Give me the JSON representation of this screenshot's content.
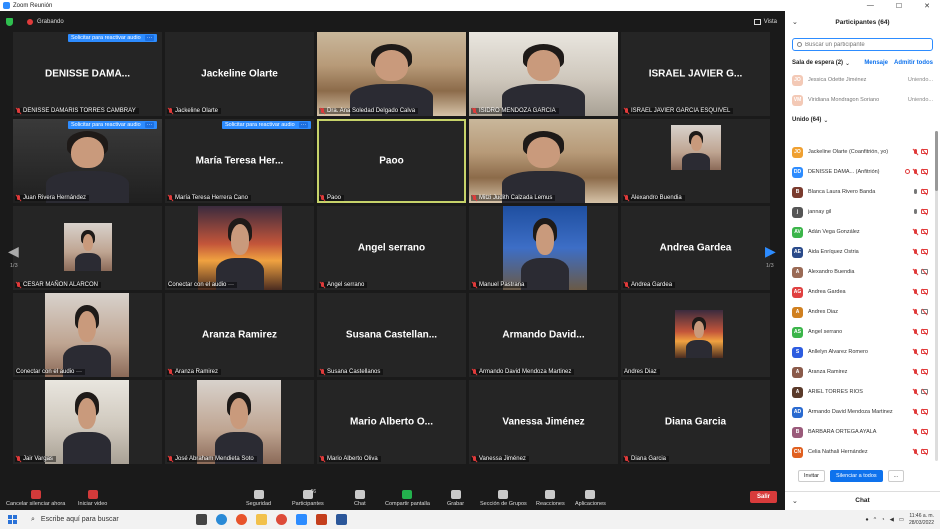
{
  "window": {
    "title": "Zoom Reunión"
  },
  "topbar": {
    "recording_label": "Grabando",
    "view_label": "Vista"
  },
  "unmute_request": {
    "label": "Solicitar para reactivar audio",
    "more": "···"
  },
  "tiles": [
    {
      "display": "DENISSE  DAMA...",
      "label": "DENISSE DAMARIS TORRES CAMBRAY",
      "video": false,
      "request": true
    },
    {
      "display": "Jackeline Olarte",
      "label": "Jackeline Olarte",
      "video": false,
      "request": false
    },
    {
      "display": "",
      "label": "Dra. Ana Soledad Delgado Calva",
      "video": true,
      "request": false
    },
    {
      "display": "",
      "label": "ISIDRO MENDOZA GARCIA",
      "video": true,
      "request": false
    },
    {
      "display": "ISRAEL JAVIER G...",
      "label": "ISRAEL JAVIER GARCIA ESQUIVEL",
      "video": false,
      "request": false
    },
    {
      "display": "",
      "label": "Juan Rivera Hernández",
      "video": true,
      "request": true
    },
    {
      "display": "María Teresa Her...",
      "label": "María Teresa Herrera Cano",
      "video": false,
      "request": true
    },
    {
      "display": "Paoo",
      "label": "Paoo",
      "video": false,
      "request": false,
      "active": true
    },
    {
      "display": "",
      "label": "Mitzi Judith Calzada Lemus",
      "video": true,
      "request": false
    },
    {
      "display": "",
      "label": "Alexandro Buendia",
      "video": true,
      "request": false
    },
    {
      "display": "",
      "label": "CESAR MAÑON ALARCON",
      "video": true,
      "request": false
    },
    {
      "display": "",
      "label": "Conectar con el audio ···",
      "video": true,
      "request": false,
      "nomic": true
    },
    {
      "display": "Angel serrano",
      "label": "Angel serrano",
      "video": false,
      "request": false
    },
    {
      "display": "",
      "label": "Manuel Pastrana",
      "video": true,
      "request": false
    },
    {
      "display": "Andrea Gardea",
      "label": "Andrea Gardea",
      "video": false,
      "request": false
    },
    {
      "display": "",
      "label": "Conectar con el audio ···",
      "video": true,
      "request": false,
      "nomic": true
    },
    {
      "display": "Aranza Ramirez",
      "label": "Aranza Ramirez",
      "video": false,
      "request": false
    },
    {
      "display": "Susana  Castellan...",
      "label": "Susana Castellanos",
      "video": false,
      "request": false
    },
    {
      "display": "Armando  David...",
      "label": "Armando David Mendoza Martinez",
      "video": false,
      "request": false
    },
    {
      "display": "",
      "label": "Andres Diaz",
      "video": true,
      "request": false,
      "nomic": true
    },
    {
      "display": "",
      "label": "Jair Vargas",
      "video": true,
      "request": false
    },
    {
      "display": "",
      "label": "José Abraham Mendieta Soto",
      "video": true,
      "request": false
    },
    {
      "display": "Mario Alberto O...",
      "label": "Mario Alberto Oliva",
      "video": false,
      "request": false
    },
    {
      "display": "Vanessa Jiménez",
      "label": "Vanessa Jiménez",
      "video": false,
      "request": false
    },
    {
      "display": "Diana Garcia",
      "label": "Diana Garcia",
      "video": false,
      "request": false
    }
  ],
  "pager": {
    "left": "1/3",
    "right": "1/3"
  },
  "toolbar": {
    "mute": "Cancelar silenciar ahora",
    "video": "Iniciar video",
    "security": "Seguridad",
    "participants": "Participantes",
    "participants_count": "66",
    "chat": "Chat",
    "share": "Compartir pantalla",
    "record": "Grabar",
    "breakout": "Sección de Grupos",
    "reactions": "Reacciones",
    "apps": "Aplicaciones",
    "leave": "Salir"
  },
  "panel": {
    "title": "Participantes (64)",
    "search_placeholder": "Buscar un participante",
    "waiting_room": {
      "label": "Sala de espera (2)",
      "message": "Mensaje",
      "admit_all": "Admitir todos"
    },
    "waiting": [
      {
        "initials": "JO",
        "name": "Jessica Odette Jiménez",
        "status": "Uniendo...",
        "color": "#f3c9b6"
      },
      {
        "initials": "VM",
        "name": "Viridiana Mondragon Soriano",
        "status": "Uniendo...",
        "color": "#f3c9b6"
      }
    ],
    "joined_label": "Unido (64)",
    "participants": [
      {
        "initials": "JO",
        "name": "Jackeline Olarte (Coanfitrión, yo)",
        "color": "#f0a030",
        "mic": "off",
        "cam": "off"
      },
      {
        "initials": "DD",
        "name": "DENISSE DAMA...  (Anfitrión)",
        "color": "#2d8cff",
        "mic": "off",
        "cam": "off",
        "rec": true
      },
      {
        "initials": "B",
        "name": "Blanca Laura Rivero Banda",
        "color": "#7a3b2e",
        "mic": "on",
        "cam": "off"
      },
      {
        "initials": "j",
        "name": "jannay gil",
        "color": "#555",
        "mic": "on",
        "cam": "off"
      },
      {
        "initials": "AV",
        "name": "Adán Vega González",
        "color": "#3bb54a",
        "mic": "off",
        "cam": "off"
      },
      {
        "initials": "AE",
        "name": "Aida Enríquez Ostria",
        "color": "#2a4a8a",
        "mic": "off",
        "cam": "off"
      },
      {
        "initials": "A",
        "name": "Alexandro Buendia",
        "color": "#9a6a55",
        "mic": "off",
        "cam": "on"
      },
      {
        "initials": "AG",
        "name": "Andrea Gardea",
        "color": "#e04040",
        "mic": "off",
        "cam": "off"
      },
      {
        "initials": "A",
        "name": "Andres Diaz",
        "color": "#d08020",
        "mic": "off",
        "cam": "on"
      },
      {
        "initials": "AS",
        "name": "Angel serrano",
        "color": "#3bb54a",
        "mic": "off",
        "cam": "off"
      },
      {
        "initials": "S",
        "name": "Anllelyn Alvarez Romero",
        "color": "#2d5ce0",
        "mic": "off",
        "cam": "off"
      },
      {
        "initials": "A",
        "name": "Aranza Ramirez",
        "color": "#8a5a4a",
        "mic": "off",
        "cam": "off"
      },
      {
        "initials": "A",
        "name": "ARIEL TORRES RIOS",
        "color": "#5a3a2a",
        "mic": "off",
        "cam": "on"
      },
      {
        "initials": "AD",
        "name": "Armando David Mendoza Martinez",
        "color": "#2a6ad0",
        "mic": "off",
        "cam": "off"
      },
      {
        "initials": "B",
        "name": "BARBARA ORTEGA AYALA",
        "color": "#9a5a7a",
        "mic": "off",
        "cam": "off"
      },
      {
        "initials": "CN",
        "name": "Celia Nathali Hernández",
        "color": "#e06020",
        "mic": "off",
        "cam": "off"
      }
    ],
    "invite": "Invitar",
    "mute_all": "Silenciar a todos",
    "more": "...",
    "chat_label": "Chat"
  },
  "taskbar": {
    "search_placeholder": "Escribe aquí para buscar",
    "time": "11:46 a. m.",
    "date": "28/03/2022"
  }
}
